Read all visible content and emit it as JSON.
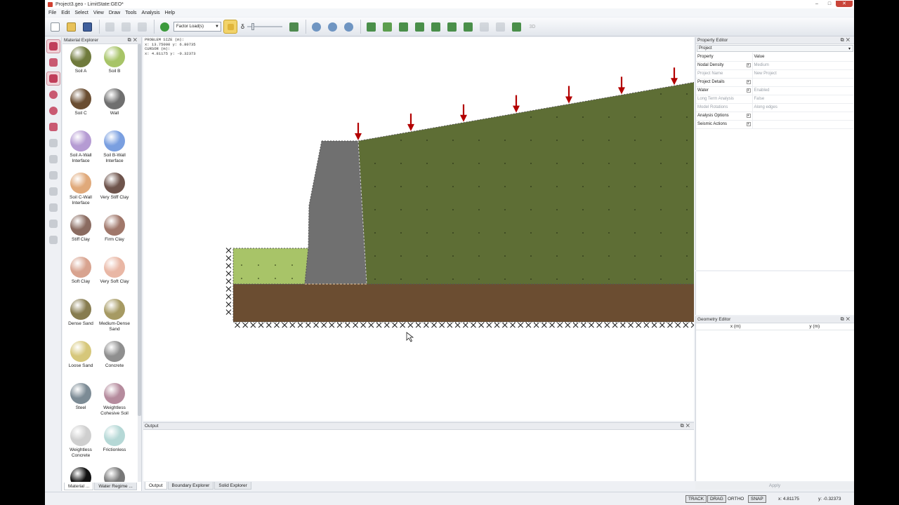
{
  "window": {
    "title": "Project3.geo - LimitState:GEO*",
    "min": "–",
    "max": "□",
    "close": "✕"
  },
  "menu": [
    "File",
    "Edit",
    "Select",
    "View",
    "Draw",
    "Tools",
    "Analysis",
    "Help"
  ],
  "toolbar": {
    "analysis_mode": "Factor Load(s)",
    "delta_symbol": "δ",
    "view3d_label": "3D"
  },
  "material_explorer": {
    "title": "Material Explorer",
    "items": [
      {
        "label": "Soil A",
        "color": "#6f7a3c"
      },
      {
        "label": "Soil B",
        "color": "#a7c467"
      },
      {
        "label": "Soil C",
        "color": "#6a4d31"
      },
      {
        "label": "Wall",
        "color": "#6f6f6f"
      },
      {
        "label": "Soil A-Wall Interface",
        "color": "#b59bd3"
      },
      {
        "label": "Soil B-Wall Interface",
        "color": "#7a9fe0"
      },
      {
        "label": "Soil C-Wall Interface",
        "color": "#e0a97a"
      },
      {
        "label": "Very Stiff Clay",
        "color": "#6e544c"
      },
      {
        "label": "Stiff Clay",
        "color": "#8a6b60"
      },
      {
        "label": "Firm Clay",
        "color": "#a0776a"
      },
      {
        "label": "Soft Clay",
        "color": "#d8a38f"
      },
      {
        "label": "Very Soft Clay",
        "color": "#e9b7a5"
      },
      {
        "label": "Dense Sand",
        "color": "#877c4f"
      },
      {
        "label": "Medium-Dense Sand",
        "color": "#a69a63"
      },
      {
        "label": "Loose Sand",
        "color": "#d6c77a"
      },
      {
        "label": "Concrete",
        "color": "#8f8f8f"
      },
      {
        "label": "Steel",
        "color": "#7c8b95"
      },
      {
        "label": "Weightless Cohesive Soil",
        "color": "#b58b9d"
      },
      {
        "label": "Weightless Concrete",
        "color": "#cfcfcf"
      },
      {
        "label": "Frictionless",
        "color": "#b5d8d6"
      },
      {
        "label": "",
        "color": "#111111"
      },
      {
        "label": "",
        "color": "#777777"
      }
    ],
    "tabs": [
      "Material ...",
      "Water Regime ..."
    ]
  },
  "viewport": {
    "readout_lines": [
      "PROBLEM SIZE (m):",
      "x: 13.75000 y: 6.80735",
      "CURSOR (m):",
      "x: 4.81175 y: -0.32373"
    ],
    "soil_top_color": "#5e6e35",
    "fill_color": "#a8c468",
    "soil_base_color": "#6b4d31",
    "wall_color": "#707070",
    "load_color": "#b30000"
  },
  "output": {
    "title": "Output",
    "tabs": [
      "Output",
      "Boundary Explorer",
      "Solid Explorer"
    ]
  },
  "property_editor": {
    "title": "Property Editor",
    "selector": "Project",
    "header": {
      "property": "Property",
      "value": "Value"
    },
    "rows": [
      {
        "key": "Nodal Density",
        "value": "Medium",
        "expand": true,
        "dim_value": true
      },
      {
        "key": "Project Name",
        "value": "New Project",
        "expand": false,
        "dim_key": true,
        "dim_value": true
      },
      {
        "key": "Project Details",
        "value": "",
        "expand": true
      },
      {
        "key": "Water",
        "value": "Enabled",
        "expand": true,
        "dim_value": true
      },
      {
        "key": "Long Term Analysis",
        "value": "False",
        "expand": false,
        "dim_key": true,
        "dim_value": true
      },
      {
        "key": "Model Rotations",
        "value": "Along edges",
        "expand": false,
        "dim_key": true,
        "dim_value": true
      },
      {
        "key": "Analysis Options",
        "value": "",
        "expand": true
      },
      {
        "key": "Seismic Actions",
        "value": "",
        "expand": true
      }
    ]
  },
  "geometry_editor": {
    "title": "Geometry Editor",
    "col_x": "x (m)",
    "col_y": "y (m)",
    "apply": "Apply"
  },
  "status": {
    "track": "TRACK",
    "drag": "DRAG",
    "ortho": "ORTHO",
    "snap": "SNAP",
    "x": "x: 4.81175",
    "y": "y: -0.32373"
  }
}
